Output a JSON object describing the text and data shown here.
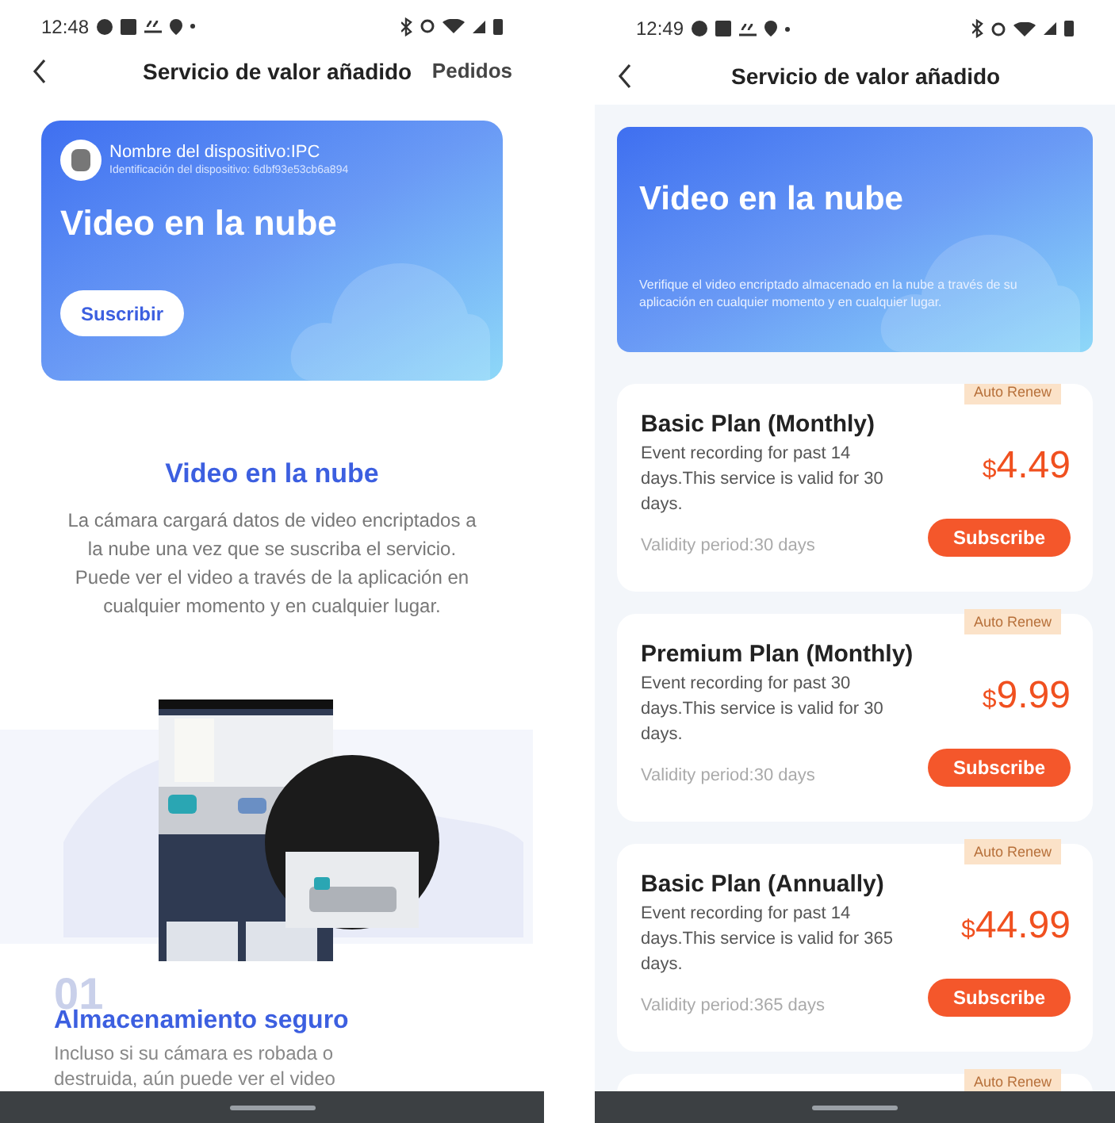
{
  "left_screen": {
    "status_bar": {
      "time": "12:48"
    },
    "header": {
      "title": "Servicio de valor añadido",
      "action": "Pedidos"
    },
    "device_card": {
      "device_name": "Nombre del dispositivo:IPC",
      "device_id": "Identificación del dispositivo: 6dbf93e53cb6a894",
      "title": "Video en la nube",
      "button": "Suscribir"
    },
    "intro": {
      "title": "Video en la nube",
      "text": "La cámara cargará datos de video encriptados a la nube una vez que se suscriba el servicio. Puede ver el video a través de la aplicación en cualquier momento y en cualquier lugar."
    },
    "feature": {
      "number": "01",
      "title": "Almacenamiento seguro",
      "text": "Incluso si su cámara es robada o destruida, aún puede ver el video"
    }
  },
  "right_screen": {
    "status_bar": {
      "time": "12:49"
    },
    "header": {
      "title": "Servicio de valor añadido"
    },
    "banner": {
      "title": "Video en la nube",
      "text": "Verifique el video encriptado almacenado en la nube a través de su aplicación en cualquier momento y en cualquier lugar."
    },
    "plans": [
      {
        "badge": "Auto Renew",
        "name": "Basic Plan (Monthly)",
        "description": "Event recording for past 14 days.This service is valid for 30 days.",
        "currency": "$",
        "amount": "4.49",
        "validity": "Validity period:30 days",
        "button": "Subscribe"
      },
      {
        "badge": "Auto Renew",
        "name": "Premium Plan (Monthly)",
        "description": "Event recording for past 30 days.This service is valid for 30 days.",
        "currency": "$",
        "amount": "9.99",
        "validity": "Validity period:30 days",
        "button": "Subscribe"
      },
      {
        "badge": "Auto Renew",
        "name": "Basic Plan (Annually)",
        "description": "Event recording for past 14 days.This service is valid for 365 days.",
        "currency": "$",
        "amount": "44.99",
        "validity": "Validity period:365 days",
        "button": "Subscribe"
      },
      {
        "badge": "Auto Renew"
      }
    ]
  }
}
